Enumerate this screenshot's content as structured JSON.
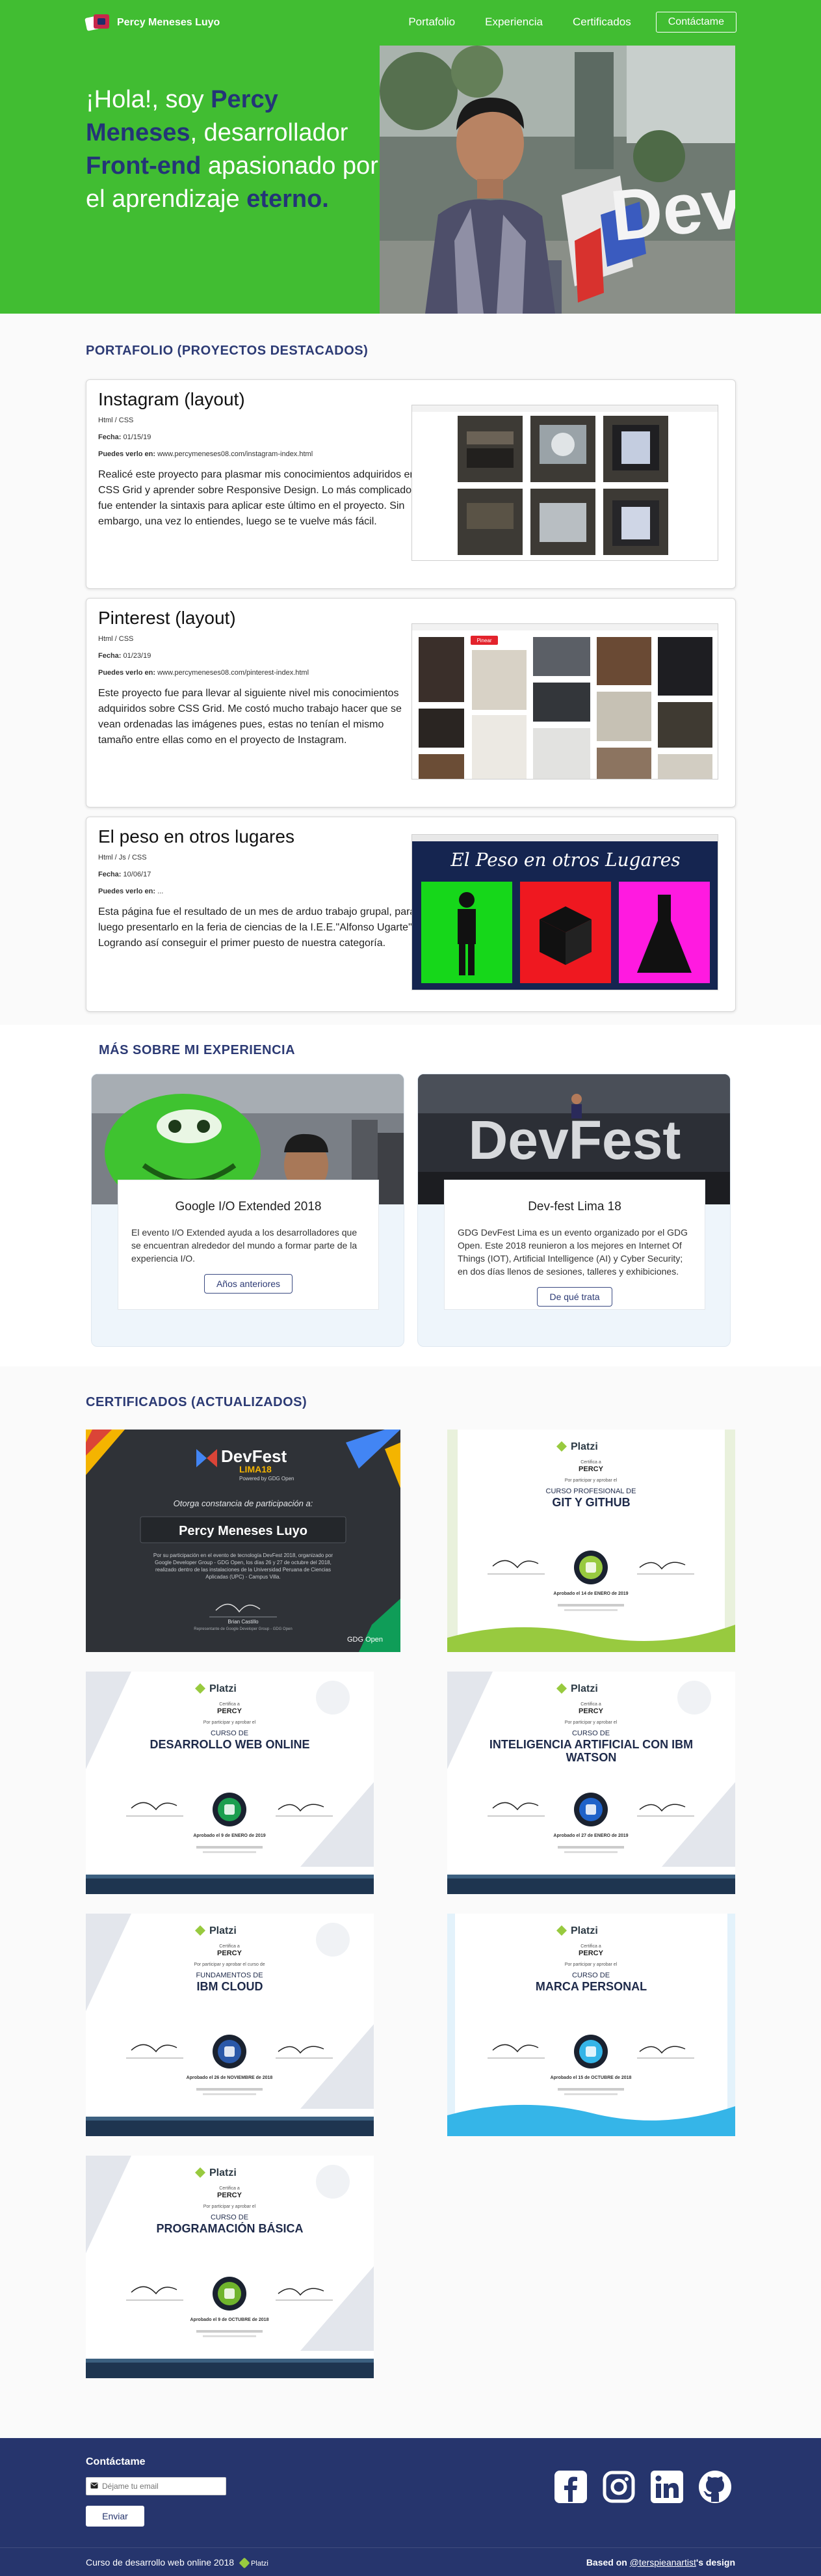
{
  "header": {
    "brand": "Percy Meneses Luyo",
    "nav": [
      "Portafolio",
      "Experiencia",
      "Certificados"
    ],
    "contact_label": "Contáctame",
    "bg_color": "#41bd32",
    "accent_color": "#233577"
  },
  "hero": {
    "part1": "¡Hola!, soy ",
    "name": "Percy Meneses",
    "part2": ", desarrollador ",
    "role": "Front-end",
    "part3": " apasionado por el aprendizaje ",
    "word": "eterno."
  },
  "portfolio": {
    "title": "PORTAFOLIO (PROYECTOS DESTACADOS)",
    "date_label": "Fecha:",
    "link_label": "Puedes verlo en:",
    "projects": [
      {
        "title": "Instagram (layout)",
        "tags": "Html / CSS",
        "date": "01/15/19",
        "url": "www.percymeneses08.com/instagram-index.html",
        "description": "Realicé este proyecto para plasmar mis conocimientos adquiridos en CSS Grid y aprender sobre Responsive Design. Lo más complicado fue entender la sintaxis para aplicar este último en el proyecto. Sin embargo, una vez lo entiendes, luego se te vuelve más fácil."
      },
      {
        "title": "Pinterest (layout)",
        "tags": "Html / CSS",
        "date": "01/23/19",
        "url": "www.percymeneses08.com/pinterest-index.html",
        "description": "Este proyecto fue para llevar al siguiente nivel mis conocimientos adquiridos sobre CSS Grid. Me costó mucho trabajo hacer que se vean ordenadas las imágenes pues, estas no tenían el mismo tamaño entre ellas como en el proyecto de Instagram.",
        "pin_button": "Pinear"
      },
      {
        "title": "El peso en otros lugares",
        "tags": "Html / Js / CSS",
        "date": "10/06/17",
        "url": "...",
        "description": "Esta página fue el resultado de un mes de arduo trabajo grupal, para luego presentarlo en la feria de ciencias de la I.E.E.\"Alfonso Ugarte\". Logrando así conseguir el primer puesto de nuestra categoría.",
        "banner": "El Peso en otros Lugares"
      }
    ]
  },
  "experience": {
    "title": "MÁS SOBRE MI EXPERIENCIA",
    "cards": [
      {
        "title": "Google I/O Extended 2018",
        "text": "El evento I/O Extended ayuda a los desarrolladores que se encuentran alrededor del mundo a formar parte de la experiencia I/O.",
        "button": "Años anteriores"
      },
      {
        "title": "Dev-fest Lima 18",
        "text": "GDG DevFest Lima es un evento organizado por el GDG Open. Este 2018 reunieron a los mejores en Internet Of Things (IOT), Artificial Intelligence (AI) y Cyber Security; en dos días llenos de sesiones, talleres y exhibiciones.",
        "button": "De qué trata",
        "photo_sign": "DevFest"
      }
    ]
  },
  "certificates": {
    "title": "CERTIFICADOS (ACTUALIZADOS)",
    "devfest": {
      "brand": "DevFest",
      "edition": "LIMA18",
      "powered": "Powered by GDG Open",
      "granted": "Otorga constancia de participación a:",
      "name": "Percy Meneses Luyo",
      "body": "Por su participación en el evento de tecnología DevFest 2018, organizado por Google Developer Group - GDG Open, los días 26 y 27 de octubre del 2018, realizado dentro de las instalaciones de la Universidad Peruana de Ciencias Aplicadas (UPC) - Campus Villa.",
      "signer": "Brian Castillo",
      "signer_role": "Representante de Google Developer Group - GDG Open",
      "org": "GDG Open"
    },
    "platzi_brand": "Platzi",
    "certifica_a": "Certifica a",
    "student": "PERCY",
    "items": [
      {
        "kind_line": "Por participar y aprobar el",
        "prefix": "CURSO PROFESIONAL DE",
        "name": "GIT Y GITHUB",
        "date": "Aprobado el 14 de ENERO de 2019",
        "icon": "git-icon"
      },
      {
        "kind_line": "Por participar y aprobar el",
        "prefix": "CURSO DE",
        "name": "DESARROLLO WEB ONLINE",
        "date": "Aprobado el 9 de ENERO de 2019",
        "icon": "web-icon"
      },
      {
        "kind_line": "Por participar y aprobar el",
        "prefix": "CURSO DE",
        "name": "INTELIGENCIA ARTIFICIAL CON IBM WATSON",
        "date": "Aprobado el 27 de ENERO de 2019",
        "icon": "watson-icon"
      },
      {
        "kind_line": "Por participar y aprobar el curso de",
        "prefix": "FUNDAMENTOS DE",
        "name": "IBM CLOUD",
        "date": "Aprobado el 26 de NOVIEMBRE de 2018",
        "icon": "cloud-icon"
      },
      {
        "kind_line": "Por participar y aprobar el",
        "prefix": "CURSO DE",
        "name": "MARCA PERSONAL",
        "date": "Aprobado el 15 de OCTUBRE de 2018",
        "icon": "brand-icon"
      },
      {
        "kind_line": "Por participar y aprobar el",
        "prefix": "CURSO DE",
        "name": "PROGRAMACIÓN BÁSICA",
        "date": "Aprobado el 9 de OCTUBRE de 2018",
        "icon": "code-icon"
      }
    ]
  },
  "footer": {
    "contact_title": "Contáctame",
    "email_placeholder": "Déjame tu email",
    "send_label": "Enviar",
    "course": "Curso de desarrollo web online 2018",
    "platzi": "Platzi",
    "based_on": "Based on ",
    "designer": "@terspieanartist",
    "design_suffix": "'s design",
    "social": [
      "facebook-icon",
      "instagram-icon",
      "linkedin-icon",
      "github-icon"
    ]
  }
}
